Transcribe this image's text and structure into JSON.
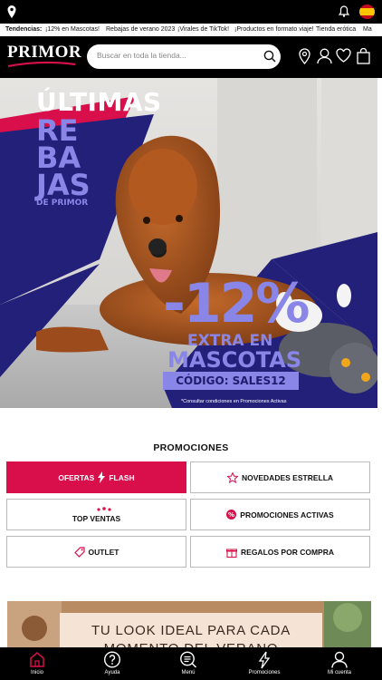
{
  "top_bar": {
    "location_icon": "location-pin-icon",
    "notification_icon": "bell-icon",
    "language_flag": "spain-flag-icon"
  },
  "trends": {
    "label": "Tendencias:",
    "items": [
      "¡12% en Mascotas!",
      "Rebajas de verano 2023",
      "¡Virales de TikTok!",
      "¡Productos en formato viaje!",
      "Tienda erótica",
      "Ma"
    ]
  },
  "header": {
    "logo_text": "PRIMOR",
    "search_placeholder": "Buscar en toda la tienda...",
    "icons": [
      "store-locator-icon",
      "account-icon",
      "wishlist-icon",
      "cart-icon"
    ]
  },
  "hero": {
    "title_top": "ÚLTIMAS",
    "title_lines": [
      "RE",
      "BA",
      "JAS"
    ],
    "subtitle": "DE PRIMOR",
    "discount": "-12%",
    "line1": "EXTRA EN",
    "line2": "MASCOTAS",
    "code": "CÓDIGO: SALES12",
    "note": "*Consultar condiciones en Promociones Activas"
  },
  "promotions": {
    "title": "PROMOCIONES",
    "buttons": [
      {
        "label": "OFERTAS",
        "label2": "FLASH"
      },
      {
        "label": "NOVEDADES ESTRELLA"
      },
      {
        "label": "TOP VENTAS"
      },
      {
        "label": "PROMOCIONES ACTIVAS"
      },
      {
        "label": "OUTLET"
      },
      {
        "label": "REGALOS POR COMPRA"
      }
    ]
  },
  "summer_banner": {
    "line1": "TU LOOK IDEAL PARA CADA",
    "line2": "MOMENTO DEL VERANO"
  },
  "bottom_nav": [
    {
      "label": "Inicio",
      "icon": "home-icon"
    },
    {
      "label": "Ayuda",
      "icon": "help-icon"
    },
    {
      "label": "Menú",
      "icon": "menu-search-icon"
    },
    {
      "label": "Promociones",
      "icon": "flash-icon"
    },
    {
      "label": "Mi cuenta",
      "icon": "user-icon"
    }
  ],
  "colors": {
    "accent": "#d80f4b",
    "hero_navy": "#23207a",
    "hero_lilac": "#8a86e8",
    "header_bg": "#000000"
  }
}
